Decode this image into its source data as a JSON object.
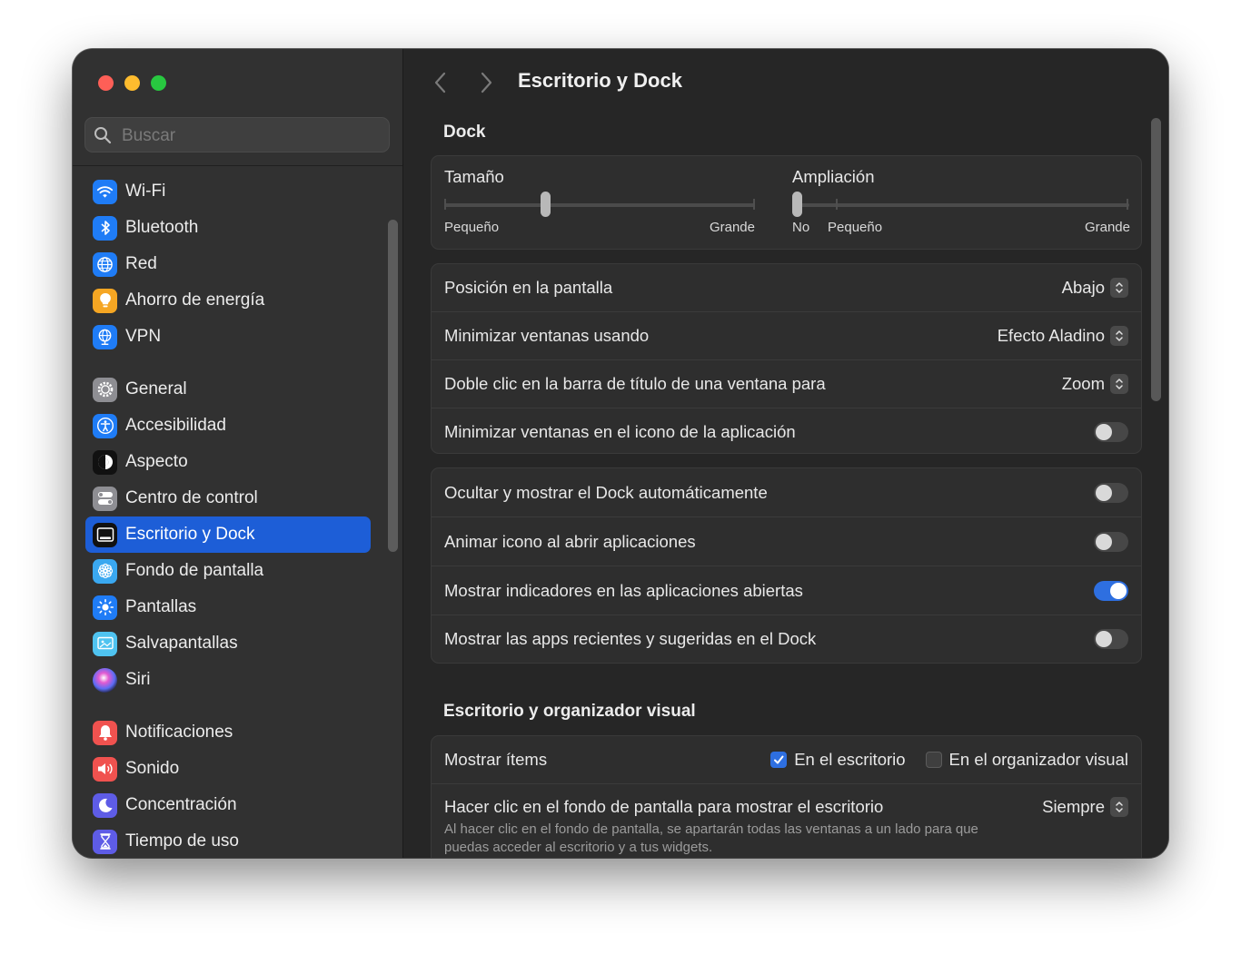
{
  "sidebar": {
    "search_placeholder": "Buscar",
    "items": [
      {
        "label": "Wi-Fi",
        "icon": "wifi-icon",
        "color": "#1f7cf6"
      },
      {
        "label": "Bluetooth",
        "icon": "bluetooth-icon",
        "color": "#1f7cf6"
      },
      {
        "label": "Red",
        "icon": "globe-icon",
        "color": "#1f7cf6"
      },
      {
        "label": "Ahorro de energía",
        "icon": "lightbulb-icon",
        "color": "#f5a623"
      },
      {
        "label": "VPN",
        "icon": "globe-network-icon",
        "color": "#1f7cf6"
      },
      {
        "label": "General",
        "icon": "gear-icon",
        "color": "#8e8e93"
      },
      {
        "label": "Accesibilidad",
        "icon": "accessibility-icon",
        "color": "#1f7cf6"
      },
      {
        "label": "Aspecto",
        "icon": "appearance-icon",
        "color": "#111111"
      },
      {
        "label": "Centro de control",
        "icon": "control-center-icon",
        "color": "#8e8e93"
      },
      {
        "label": "Escritorio y Dock",
        "icon": "dock-icon",
        "color": "#111111",
        "selected": true
      },
      {
        "label": "Fondo de pantalla",
        "icon": "wallpaper-icon",
        "color": "#3aa8f0"
      },
      {
        "label": "Pantallas",
        "icon": "sun-icon",
        "color": "#1f7cf6"
      },
      {
        "label": "Salvapantallas",
        "icon": "screensaver-icon",
        "color": "#4fc3f0"
      },
      {
        "label": "Siri",
        "icon": "siri-icon",
        "color": "#222222"
      },
      {
        "label": "Notificaciones",
        "icon": "bell-icon",
        "color": "#f0524f"
      },
      {
        "label": "Sonido",
        "icon": "speaker-icon",
        "color": "#f0524f"
      },
      {
        "label": "Concentración",
        "icon": "moon-icon",
        "color": "#5e5ce6"
      },
      {
        "label": "Tiempo de uso",
        "icon": "hourglass-icon",
        "color": "#5e5ce6"
      }
    ]
  },
  "header": {
    "title": "Escritorio y Dock"
  },
  "dock": {
    "section_title": "Dock",
    "size": {
      "label": "Tamaño",
      "min_label": "Pequeño",
      "max_label": "Grande",
      "value_fraction": 0.32
    },
    "magnification": {
      "label": "Ampliación",
      "off_label": "No",
      "min_label": "Pequeño",
      "max_label": "Grande",
      "value_fraction": 0.0
    },
    "popups": [
      {
        "label": "Posición en la pantalla",
        "value": "Abajo"
      },
      {
        "label": "Minimizar ventanas usando",
        "value": "Efecto Aladino"
      },
      {
        "label": "Doble clic en la barra de título de una ventana para",
        "value": "Zoom"
      }
    ],
    "minimize_into_app": {
      "label": "Minimizar ventanas en el icono de la aplicación",
      "on": false
    },
    "toggles": [
      {
        "label": "Ocultar y mostrar el Dock automáticamente",
        "on": false
      },
      {
        "label": "Animar icono al abrir aplicaciones",
        "on": false
      },
      {
        "label": "Mostrar indicadores en las aplicaciones abiertas",
        "on": true
      },
      {
        "label": "Mostrar las apps recientes y sugeridas en el Dock",
        "on": false
      }
    ]
  },
  "desktop": {
    "section_title": "Escritorio y organizador visual",
    "show_items": {
      "label": "Mostrar ítems",
      "desktop_label": "En el escritorio",
      "desktop_checked": true,
      "stage_label": "En el organizador visual",
      "stage_checked": false
    },
    "click_wallpaper": {
      "label": "Hacer clic en el fondo de pantalla para mostrar el escritorio",
      "value": "Siempre",
      "description": "Al hacer clic en el fondo de pantalla, se apartarán todas las ventanas a un lado para que puedas acceder al escritorio y a tus widgets."
    }
  },
  "colors": {
    "accent": "#2e6fe0",
    "selection": "#1d5ed7"
  }
}
